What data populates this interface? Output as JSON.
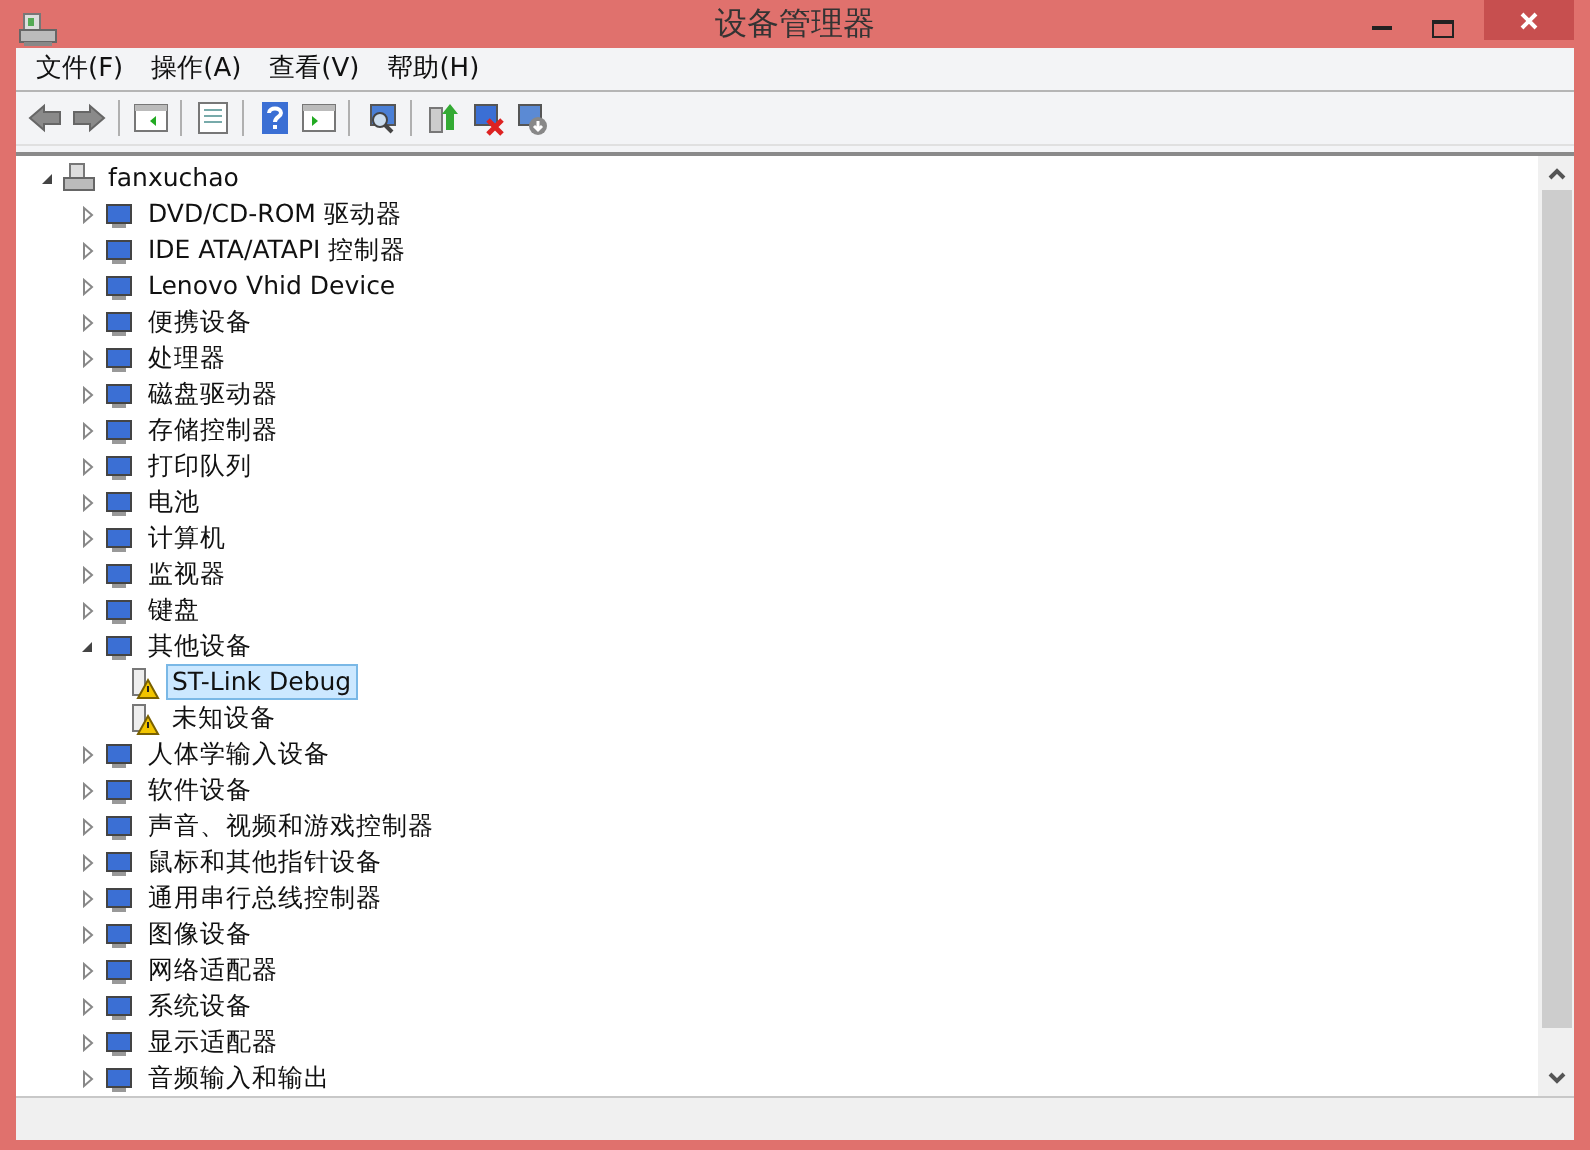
{
  "window": {
    "title": "设备管理器"
  },
  "menu": [
    "文件(F)",
    "操作(A)",
    "查看(V)",
    "帮助(H)"
  ],
  "tree": {
    "label": "fanxuchao",
    "expanded": true,
    "children": [
      {
        "label": "DVD/CD-ROM 驱动器",
        "expanded": false
      },
      {
        "label": "IDE ATA/ATAPI 控制器",
        "expanded": false
      },
      {
        "label": "Lenovo Vhid Device",
        "expanded": false
      },
      {
        "label": "便携设备",
        "expanded": false
      },
      {
        "label": "处理器",
        "expanded": false
      },
      {
        "label": "磁盘驱动器",
        "expanded": false
      },
      {
        "label": "存储控制器",
        "expanded": false
      },
      {
        "label": "打印队列",
        "expanded": false
      },
      {
        "label": "电池",
        "expanded": false
      },
      {
        "label": "计算机",
        "expanded": false
      },
      {
        "label": "监视器",
        "expanded": false
      },
      {
        "label": "键盘",
        "expanded": false
      },
      {
        "label": "其他设备",
        "expanded": true,
        "children": [
          {
            "label": "ST-Link Debug",
            "selected": true,
            "warning": true
          },
          {
            "label": "未知设备",
            "selected": false,
            "warning": true
          }
        ]
      },
      {
        "label": "人体学输入设备",
        "expanded": false
      },
      {
        "label": "软件设备",
        "expanded": false
      },
      {
        "label": "声音、视频和游戏控制器",
        "expanded": false
      },
      {
        "label": "鼠标和其他指针设备",
        "expanded": false
      },
      {
        "label": "通用串行总线控制器",
        "expanded": false
      },
      {
        "label": "图像设备",
        "expanded": false
      },
      {
        "label": "网络适配器",
        "expanded": false
      },
      {
        "label": "系统设备",
        "expanded": false
      },
      {
        "label": "显示适配器",
        "expanded": false
      },
      {
        "label": "音频输入和输出",
        "expanded": false
      }
    ]
  }
}
